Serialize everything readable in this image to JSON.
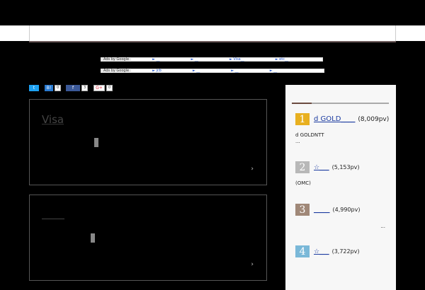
{
  "ads": {
    "label": "Ads by Google",
    "row1": [
      "► __",
      "► __",
      "► Visa__",
      "► etc__"
    ],
    "row2": [
      "► jcb",
      "► __",
      "► __",
      "► __"
    ]
  },
  "share": {
    "twitter_glyph": "t",
    "hatena_glyph": "B!",
    "hatena_count": "0",
    "facebook_glyph": "f",
    "facebook_count": "3",
    "googleplus_glyph": "G+",
    "googleplus_count": "0"
  },
  "articles": [
    {
      "title": "Visa",
      "chevron": "›"
    },
    {
      "title": "",
      "chevron": "›"
    }
  ],
  "sidebar": {
    "ranking": [
      {
        "badge": "1",
        "badge_color": "#e8b020",
        "title": "d GOLD____",
        "pv": "(8,009pv)",
        "desc": [
          "d GOLDNTT",
          "..."
        ]
      },
      {
        "badge": "2",
        "badge_color": "#b8b8b8",
        "title": "☆___",
        "pv": "(5,153pv)",
        "desc": [
          "(OMC)"
        ]
      },
      {
        "badge": "3",
        "badge_color": "#a08878",
        "title": "_____",
        "pv": "(4,990pv)",
        "desc": [
          "..."
        ]
      },
      {
        "badge": "4",
        "badge_color": "#7ab8d8",
        "title": "☆___",
        "pv": "(3,722pv)",
        "desc": []
      }
    ]
  }
}
